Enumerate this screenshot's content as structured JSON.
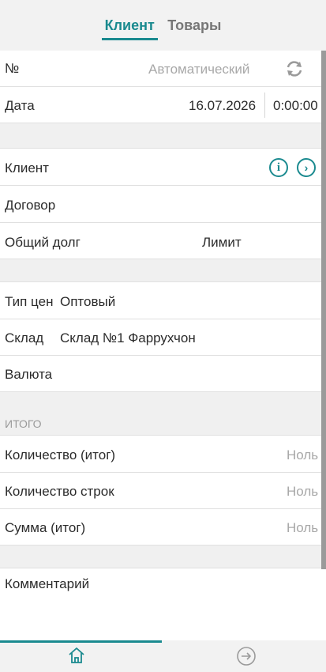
{
  "tabs": [
    {
      "label": "Клиент",
      "active": true
    },
    {
      "label": "Товары",
      "active": false
    }
  ],
  "header_fields": {
    "number_label": "№",
    "number_placeholder": "Автоматический",
    "date_label": "Дата",
    "date_value": "16.07.2026",
    "time_value": "0:00:00"
  },
  "client_section": {
    "client_label": "Клиент",
    "contract_label": "Договор",
    "total_debt_label": "Общий долг",
    "limit_label": "Лимит"
  },
  "params_section": {
    "price_type_label": "Тип цен",
    "price_type_value": "Оптовый",
    "warehouse_label": "Склад",
    "warehouse_value": "Склад №1 Фаррухчон",
    "currency_label": "Валюта"
  },
  "totals_section": {
    "header": "ИТОГО",
    "rows": [
      {
        "label": "Количество (итог)",
        "value": "Ноль"
      },
      {
        "label": "Количество строк",
        "value": "Ноль"
      },
      {
        "label": "Сумма (итог)",
        "value": "Ноль"
      }
    ]
  },
  "comment": {
    "label": "Комментарий"
  },
  "icons": {
    "refresh": "refresh-icon",
    "info": "info-icon",
    "chevron": "chevron-right-icon",
    "home": "home-icon",
    "next": "arrow-right-circle-icon"
  },
  "colors": {
    "accent": "#1a8a8f",
    "muted": "#a8a8a8",
    "section_bg": "#f0f0f0"
  }
}
